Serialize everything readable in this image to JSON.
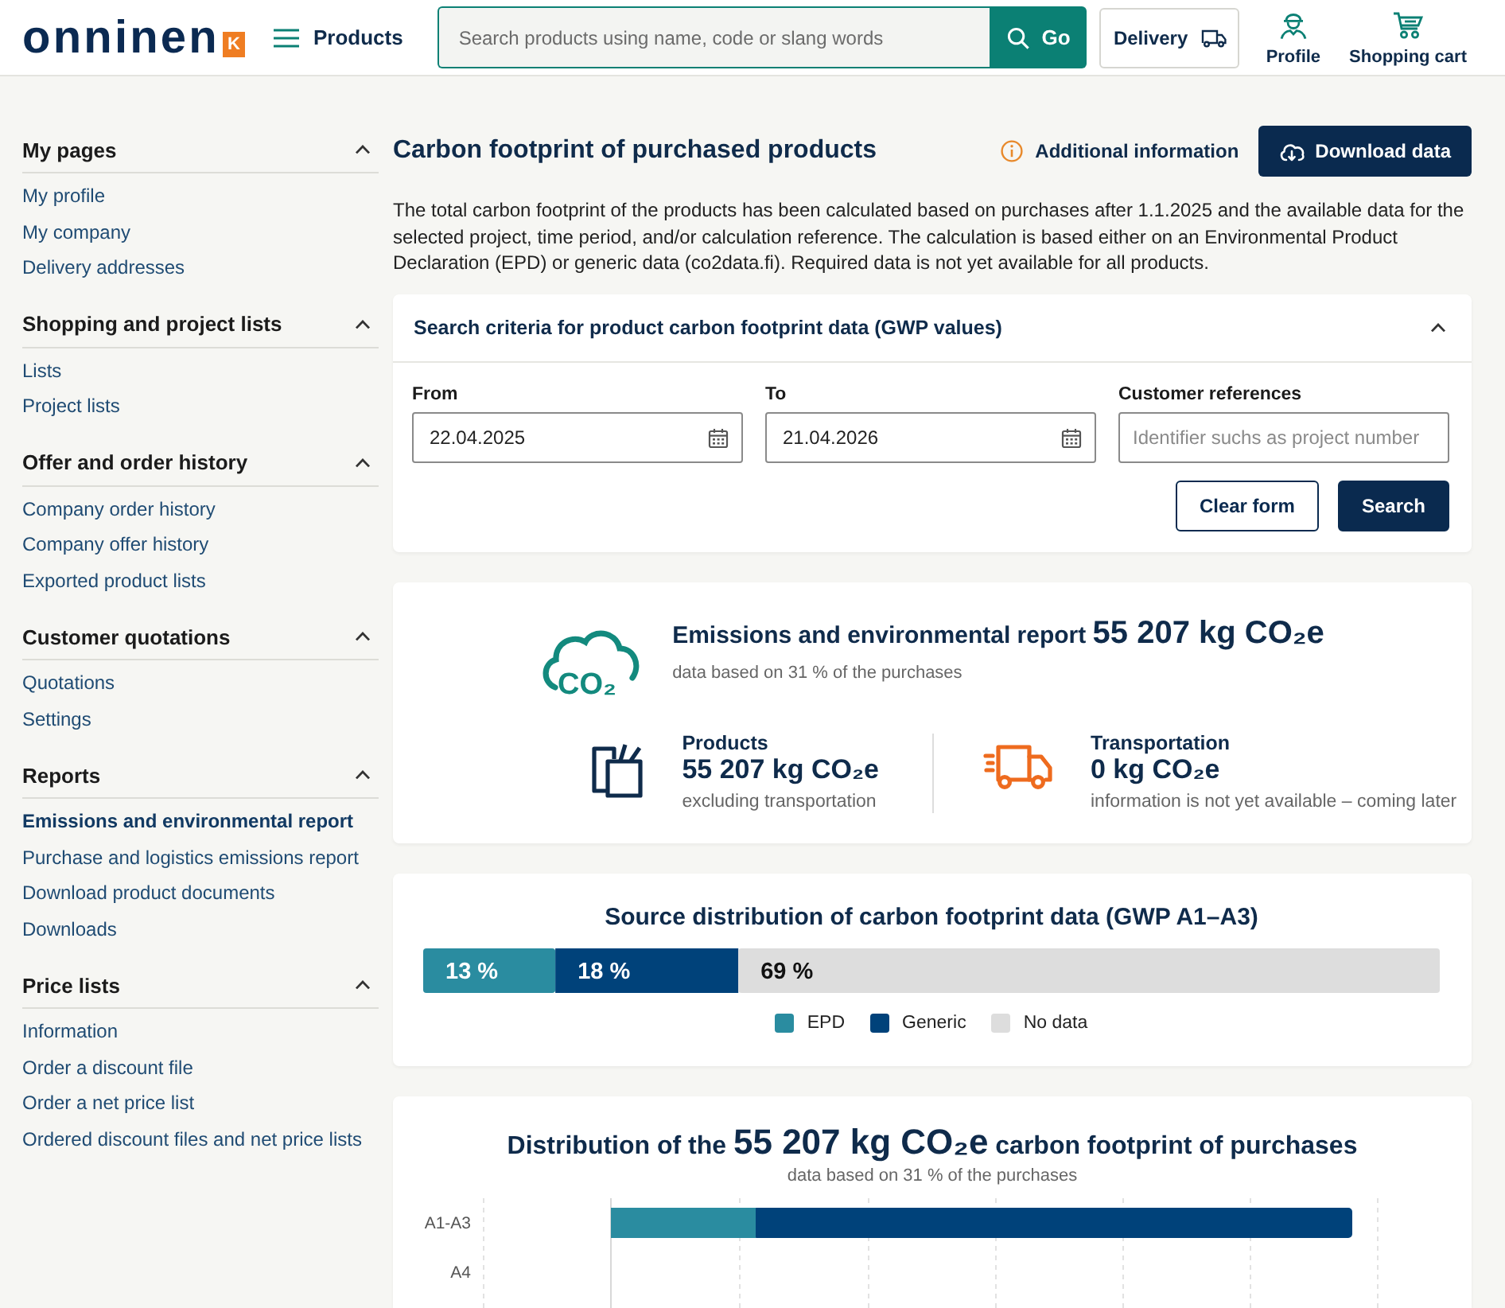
{
  "header": {
    "logo": {
      "text": "onninen",
      "badge": "K"
    },
    "menu_button": "Products",
    "search": {
      "placeholder": "Search products using name, code or slang words",
      "button": "Go"
    },
    "delivery_button": "Delivery",
    "actions": [
      {
        "kind": "profile",
        "label": "Profile"
      },
      {
        "kind": "cart",
        "label": "Shopping cart"
      }
    ]
  },
  "sidebar": {
    "sections": [
      {
        "title": "My pages",
        "expanded": true,
        "items": [
          {
            "label": "My profile",
            "selected": false
          },
          {
            "label": "My company",
            "selected": false
          },
          {
            "label": "Delivery addresses",
            "selected": false
          }
        ]
      },
      {
        "title": "Shopping and project lists",
        "expanded": true,
        "items": [
          {
            "label": "Lists",
            "selected": false
          },
          {
            "label": "Project lists",
            "selected": false
          }
        ]
      },
      {
        "title": "Offer and order history",
        "expanded": true,
        "items": [
          {
            "label": "Company order history",
            "selected": false
          },
          {
            "label": "Company offer history",
            "selected": false
          },
          {
            "label": "Exported product lists",
            "selected": false
          }
        ]
      },
      {
        "title": "Customer quotations",
        "expanded": true,
        "items": [
          {
            "label": "Quotations",
            "selected": false
          },
          {
            "label": "Settings",
            "selected": false
          }
        ]
      },
      {
        "title": "Reports",
        "expanded": true,
        "items": [
          {
            "label": "Emissions and environmental report",
            "selected": true
          },
          {
            "label": "Purchase and logistics emissions report",
            "selected": false
          },
          {
            "label": "Download product documents",
            "selected": false
          },
          {
            "label": "Downloads",
            "selected": false
          }
        ]
      },
      {
        "title": "Price lists",
        "expanded": true,
        "items": [
          {
            "label": "Information",
            "selected": false
          },
          {
            "label": "Order a discount file",
            "selected": false
          },
          {
            "label": "Order a net price list",
            "selected": false
          },
          {
            "label": "Ordered discount files and net price lists",
            "selected": false
          }
        ]
      }
    ]
  },
  "page": {
    "title": "Carbon footprint of purchased products",
    "info_link": "Additional information",
    "download_button": "Download data",
    "intro": "The total carbon footprint of the products has been calculated based on purchases after 1.1.2025 and the available data for the selected project, time period, and/or calculation reference. The calculation is based either on an Environmental Product Declaration (EPD) or generic data (co2data.fi). Required data is not yet available for all products."
  },
  "search_criteria": {
    "title": "Search criteria for product carbon footprint data (GWP values)",
    "expanded": true,
    "fields": [
      {
        "kind": "date",
        "label": "From",
        "value": "22.04.2025"
      },
      {
        "kind": "date",
        "label": "To",
        "value": "21.04.2026"
      },
      {
        "kind": "text",
        "label": "Customer references",
        "placeholder": "Identifier suchs as project number"
      }
    ],
    "buttons": [
      {
        "kind": "secondary",
        "label": "Clear form"
      },
      {
        "kind": "primary",
        "label": "Search"
      }
    ]
  },
  "emissions_report": {
    "icon_text": "CO₂",
    "title": "Emissions and environmental report",
    "amount": "55 207 kg CO₂e",
    "subtitle": "data based on 31 % of the purchases",
    "stats": [
      {
        "kind": "products",
        "title": "Products",
        "amount": "55 207 kg CO₂e",
        "note": "excluding transportation"
      },
      {
        "kind": "transportation",
        "title": "Transportation",
        "amount": "0 kg CO₂e",
        "note": "information is not yet available – coming later"
      }
    ]
  },
  "source_distribution": {
    "value_unit": "%",
    "chart_data": {
      "type": "bar",
      "orientation": "horizontal",
      "stacked": true,
      "title": "Source distribution of carbon footprint data (GWP A1–A3)",
      "series": [
        {
          "name": "EPD",
          "color": "#2a8ca0",
          "values": [
            13
          ]
        },
        {
          "name": "Generic",
          "color": "#00427a",
          "values": [
            18
          ]
        },
        {
          "name": "No data",
          "color": "#dddddd",
          "values": [
            69
          ]
        }
      ],
      "data_labels": true,
      "legend": "bottom"
    }
  },
  "footprint_distribution": {
    "title_before": "Distribution of the",
    "amount": "55 207 kg CO₂e",
    "title_after": "carbon footprint of purchases",
    "subtitle": "data based on 31 % of the purchases",
    "categories": [
      "A1-A3",
      "A4"
    ]
  }
}
